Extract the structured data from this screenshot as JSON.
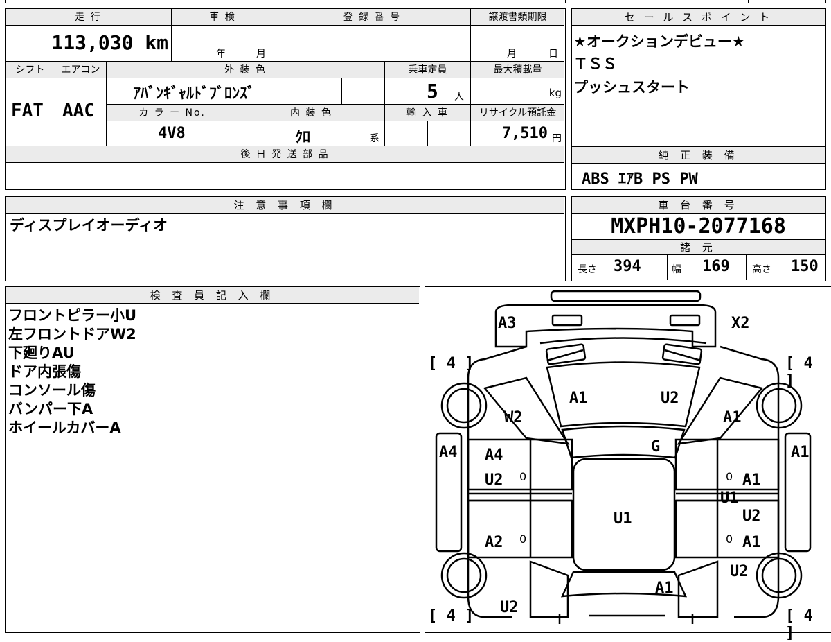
{
  "form": {
    "mileage": {
      "label": "走 行",
      "value": "113,030 km"
    },
    "inspection": {
      "label": "車 検",
      "year_unit": "年",
      "month_unit": "月"
    },
    "registration": {
      "label": "登 録 番 号",
      "value": ""
    },
    "transfer": {
      "label": "譲渡書類期限",
      "month_unit": "月",
      "day_unit": "日"
    },
    "shift": {
      "label": "シフト",
      "value": "FAT"
    },
    "aircon": {
      "label": "エアコン",
      "value": "AAC"
    },
    "exterior_color": {
      "label": "外 装 色",
      "value": "ｱﾊﾞﾝｷﾞｬﾙﾄﾞﾌﾞﾛﾝｽﾞ"
    },
    "capacity": {
      "label": "乗車定員",
      "value": "5",
      "unit": "人"
    },
    "max_load": {
      "label": "最大積載量",
      "value": "",
      "unit": "kg"
    },
    "color_no": {
      "label": "カ ラ ー No.",
      "value": "4V8"
    },
    "interior_color": {
      "label": "内 装 色",
      "value": "ｸﾛ",
      "suffix": "系"
    },
    "import": {
      "label": "輸 入 車",
      "value": ""
    },
    "recycle": {
      "label": "リサイクル預託金",
      "value": "7,510",
      "unit": "円"
    },
    "later_parts": {
      "label": "後 日 発 送 部 品",
      "value": ""
    },
    "notes": {
      "label": "注 意 事 項 欄",
      "value": "ディスプレイオーディオ"
    },
    "inspector": {
      "label": "検 査 員 記 入 欄",
      "lines": [
        "フロントピラー小U",
        "左フロントドアW2",
        "下廻りAU",
        "ドア内張傷",
        "コンソール傷",
        "バンパー下A",
        "ホイールカバーA"
      ]
    }
  },
  "sales_points": {
    "label": "セ ー ル ス ポ イ ン ト",
    "lines": [
      "★オークションデビュー★",
      "ＴＳＳ",
      "プッシュスタート"
    ]
  },
  "equipment": {
    "label": "純 正 装 備",
    "value": "ABS ｴｱB PS PW"
  },
  "chassis": {
    "label": "車 台 番 号",
    "value": "MXPH10-2077168"
  },
  "specs": {
    "label": "諸 元",
    "length_label": "長さ",
    "length": "394",
    "width_label": "幅",
    "width": "169",
    "height_label": "高さ",
    "height": "150"
  },
  "diagram": {
    "marks": {
      "a3": "A3",
      "x2": "X2",
      "tire_fl": "[ 4 ]",
      "tire_fr": "[ 4 ]",
      "tire_rl": "[ 4 ]",
      "tire_rr": "[ 4 ]",
      "hood_a1": "A1",
      "hood_u2": "U2",
      "w2": "W2",
      "fender_r_a1": "A1",
      "g": "G",
      "a4_left": "A4",
      "a1_right": "A1",
      "door_fl_a4": "A4",
      "door_fl_u2": "U2",
      "door_fr_a1": "A1",
      "u1_pillar": "U1",
      "roof_u1": "U1",
      "door_rr_u2": "U2",
      "door_rl_a2": "A2",
      "door_rr_a1": "A1",
      "quarter_u2": "U2",
      "trunk_a1": "A1",
      "rear_u2": "U2",
      "zero_1": "0",
      "zero_2": "0",
      "zero_3": "0",
      "zero_4": "0"
    }
  }
}
